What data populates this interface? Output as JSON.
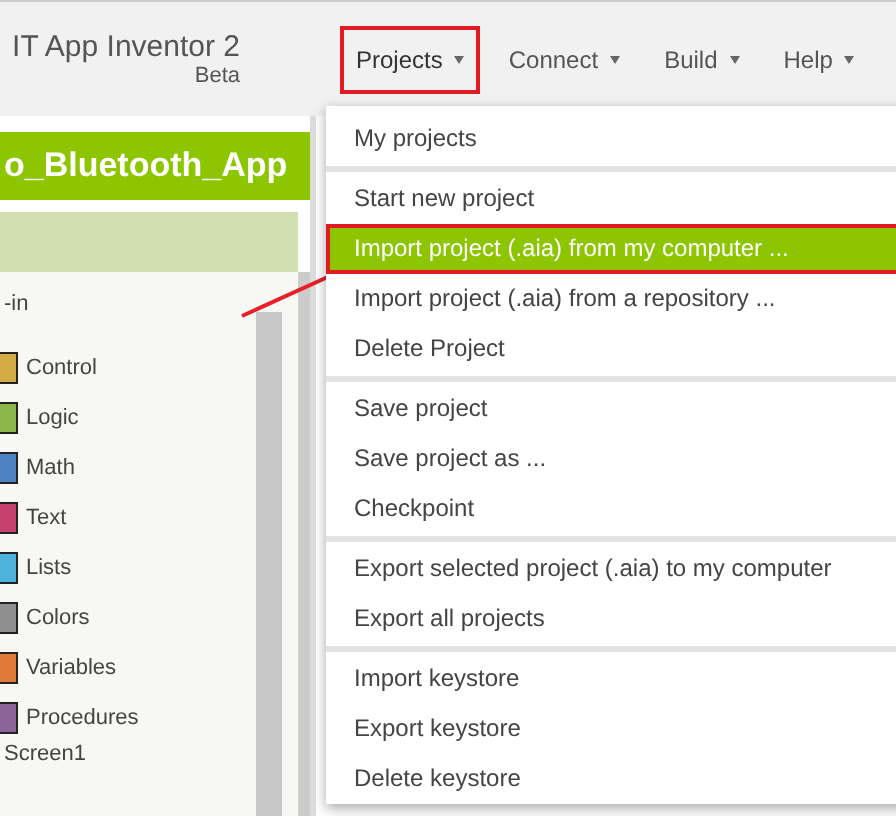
{
  "header": {
    "title": "IT App Inventor 2",
    "subtitle": "Beta"
  },
  "menu_bar": [
    {
      "label": "Projects",
      "selected": true,
      "annotated": true
    },
    {
      "label": "Connect",
      "selected": false,
      "annotated": false
    },
    {
      "label": "Build",
      "selected": false,
      "annotated": false
    },
    {
      "label": "Help",
      "selected": false,
      "annotated": false
    }
  ],
  "project_title": "o_Bluetooth_App",
  "blocks_panel": {
    "heading": "-in",
    "items": [
      {
        "label": "Control",
        "color": "#d4ac44"
      },
      {
        "label": "Logic",
        "color": "#8cb74a"
      },
      {
        "label": "Math",
        "color": "#4f82c2"
      },
      {
        "label": "Text",
        "color": "#c7416f"
      },
      {
        "label": "Lists",
        "color": "#4eb3dd"
      },
      {
        "label": "Colors",
        "color": "#8f8f8f"
      },
      {
        "label": "Variables",
        "color": "#e07838"
      },
      {
        "label": "Procedures",
        "color": "#8c6396"
      }
    ],
    "screen": "Screen1"
  },
  "dropdown": {
    "groups": [
      [
        {
          "label": "My projects",
          "selected": false,
          "annotated": false
        }
      ],
      [
        {
          "label": "Start new project",
          "selected": false,
          "annotated": false
        },
        {
          "label": "Import project (.aia) from my computer ...",
          "selected": true,
          "annotated": true
        },
        {
          "label": "Import project (.aia) from a repository ...",
          "selected": false,
          "annotated": false
        },
        {
          "label": "Delete Project",
          "selected": false,
          "annotated": false
        }
      ],
      [
        {
          "label": "Save project",
          "selected": false,
          "annotated": false
        },
        {
          "label": "Save project as ...",
          "selected": false,
          "annotated": false
        },
        {
          "label": "Checkpoint",
          "selected": false,
          "annotated": false
        }
      ],
      [
        {
          "label": "Export selected project (.aia) to my computer",
          "selected": false,
          "annotated": false
        },
        {
          "label": "Export all projects",
          "selected": false,
          "annotated": false
        }
      ],
      [
        {
          "label": "Import keystore",
          "selected": false,
          "annotated": false
        },
        {
          "label": "Export keystore",
          "selected": false,
          "annotated": false
        },
        {
          "label": "Delete keystore",
          "selected": false,
          "annotated": false
        }
      ]
    ]
  }
}
